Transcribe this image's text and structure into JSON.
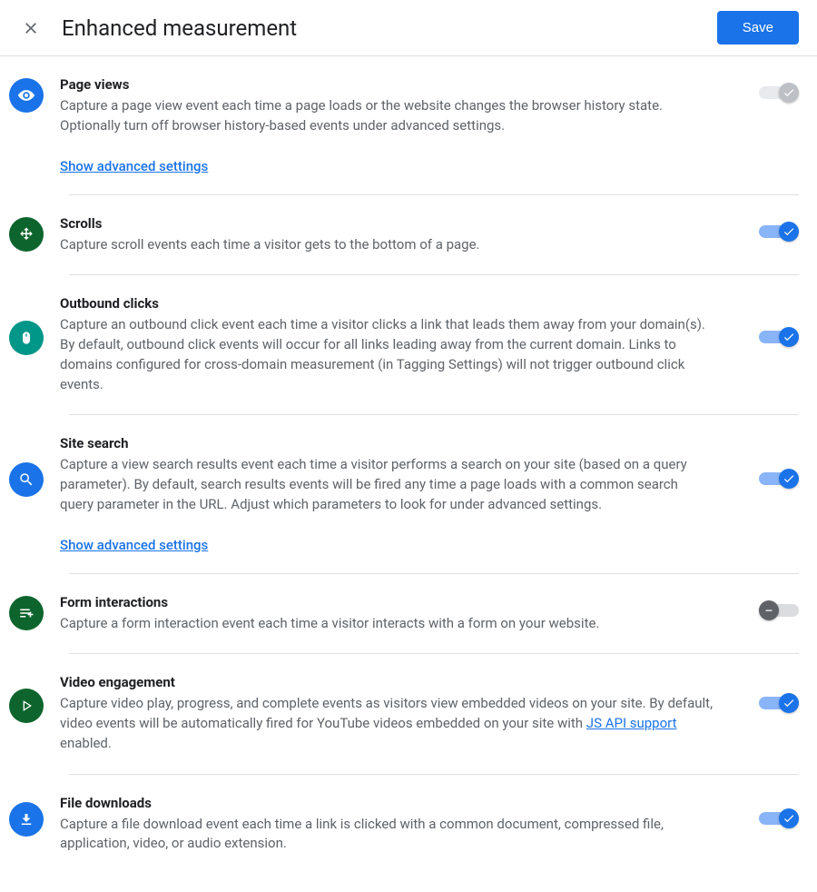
{
  "header": {
    "title": "Enhanced measurement",
    "save_label": "Save"
  },
  "links": {
    "show_advanced": "Show advanced settings",
    "js_api_support": "JS API support"
  },
  "items": {
    "page_views": {
      "title": "Page views",
      "desc": "Capture a page view event each time a page loads or the website changes the browser history state. Optionally turn off browser history-based events under advanced settings."
    },
    "scrolls": {
      "title": "Scrolls",
      "desc": "Capture scroll events each time a visitor gets to the bottom of a page."
    },
    "outbound_clicks": {
      "title": "Outbound clicks",
      "desc": "Capture an outbound click event each time a visitor clicks a link that leads them away from your domain(s). By default, outbound click events will occur for all links leading away from the current domain. Links to domains configured for cross-domain measurement (in Tagging Settings) will not trigger outbound click events."
    },
    "site_search": {
      "title": "Site search",
      "desc": "Capture a view search results event each time a visitor performs a search on your site (based on a query parameter). By default, search results events will be fired any time a page loads with a common search query parameter in the URL. Adjust which parameters to look for under advanced settings."
    },
    "form_interactions": {
      "title": "Form interactions",
      "desc": "Capture a form interaction event each time a visitor interacts with a form on your website."
    },
    "video_engagement": {
      "title": "Video engagement",
      "desc_pre": "Capture video play, progress, and complete events as visitors view embedded videos on your site. By default, video events will be automatically fired for YouTube videos embedded on your site with ",
      "desc_post": " enabled."
    },
    "file_downloads": {
      "title": "File downloads",
      "desc": "Capture a file download event each time a link is clicked with a common document, compressed file, application, video, or audio extension."
    }
  }
}
